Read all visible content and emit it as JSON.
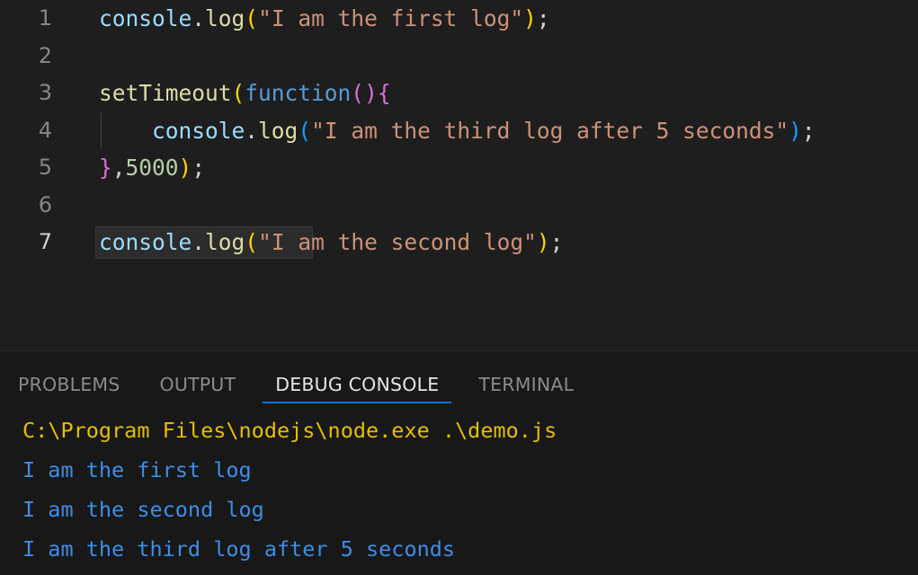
{
  "editor": {
    "language": "javascript",
    "active_line": 7,
    "lines": [
      {
        "number": "1",
        "tokens": [
          {
            "text": "console",
            "kind": "variable"
          },
          {
            "text": ".",
            "kind": "punctuation"
          },
          {
            "text": "log",
            "kind": "function"
          },
          {
            "text": "(",
            "kind": "bracket-gold"
          },
          {
            "text": "\"I am the first log\"",
            "kind": "string"
          },
          {
            "text": ")",
            "kind": "bracket-gold"
          },
          {
            "text": ";",
            "kind": "punctuation"
          }
        ],
        "plain": "console.log(\"I am the first log\");"
      },
      {
        "number": "2",
        "tokens": [],
        "plain": ""
      },
      {
        "number": "3",
        "tokens": [
          {
            "text": "setTimeout",
            "kind": "function"
          },
          {
            "text": "(",
            "kind": "bracket-gold"
          },
          {
            "text": "function",
            "kind": "keyword"
          },
          {
            "text": "(",
            "kind": "bracket-pink"
          },
          {
            "text": ")",
            "kind": "bracket-pink"
          },
          {
            "text": "{",
            "kind": "bracket-pink"
          }
        ],
        "plain": "setTimeout(function(){"
      },
      {
        "number": "4",
        "tokens": [
          {
            "text": "    ",
            "kind": "punctuation"
          },
          {
            "text": "console",
            "kind": "variable"
          },
          {
            "text": ".",
            "kind": "punctuation"
          },
          {
            "text": "log",
            "kind": "function"
          },
          {
            "text": "(",
            "kind": "bracket-blue"
          },
          {
            "text": "\"I am the third log after 5 seconds\"",
            "kind": "string"
          },
          {
            "text": ")",
            "kind": "bracket-blue"
          },
          {
            "text": ";",
            "kind": "punctuation"
          }
        ],
        "plain": "    console.log(\"I am the third log after 5 seconds\");"
      },
      {
        "number": "5",
        "tokens": [
          {
            "text": "}",
            "kind": "bracket-pink"
          },
          {
            "text": ",",
            "kind": "punctuation"
          },
          {
            "text": "5000",
            "kind": "number"
          },
          {
            "text": ")",
            "kind": "bracket-gold"
          },
          {
            "text": ";",
            "kind": "punctuation"
          }
        ],
        "plain": "},5000);"
      },
      {
        "number": "6",
        "tokens": [],
        "plain": ""
      },
      {
        "number": "7",
        "tokens": [
          {
            "text": "console",
            "kind": "variable"
          },
          {
            "text": ".",
            "kind": "punctuation"
          },
          {
            "text": "log",
            "kind": "function"
          },
          {
            "text": "(",
            "kind": "bracket-gold"
          },
          {
            "text": "\"I am the second log\"",
            "kind": "string"
          },
          {
            "text": ")",
            "kind": "bracket-gold"
          },
          {
            "text": ";",
            "kind": "punctuation"
          }
        ],
        "plain": "console.log(\"I am the second log\");"
      }
    ]
  },
  "panel": {
    "tabs": [
      {
        "label": "PROBLEMS",
        "active": false
      },
      {
        "label": "OUTPUT",
        "active": false
      },
      {
        "label": "DEBUG CONSOLE",
        "active": true
      },
      {
        "label": "TERMINAL",
        "active": false
      }
    ],
    "console_lines": [
      {
        "text": "C:\\Program Files\\nodejs\\node.exe .\\demo.js",
        "kind": "command"
      },
      {
        "text": "I am the first log",
        "kind": "log"
      },
      {
        "text": "I am the second log",
        "kind": "log"
      },
      {
        "text": "I am the third log after 5 seconds",
        "kind": "log"
      }
    ]
  },
  "colors": {
    "editor_background": "#1e1e1e",
    "panel_background": "#181818",
    "variable": "#9cdcfe",
    "function": "#dcdcaa",
    "string": "#ce9178",
    "keyword": "#569cd6",
    "number": "#b5cea8",
    "punctuation": "#d4d4d4",
    "bracket_gold": "#ffd700",
    "bracket_pink": "#da70d6",
    "bracket_blue": "#179fff",
    "line_number": "#868686",
    "line_number_active": "#d2d2d2",
    "tab_active_underline": "#0078d4",
    "console_command": "#e5bf00",
    "console_log": "#3b8eea"
  }
}
